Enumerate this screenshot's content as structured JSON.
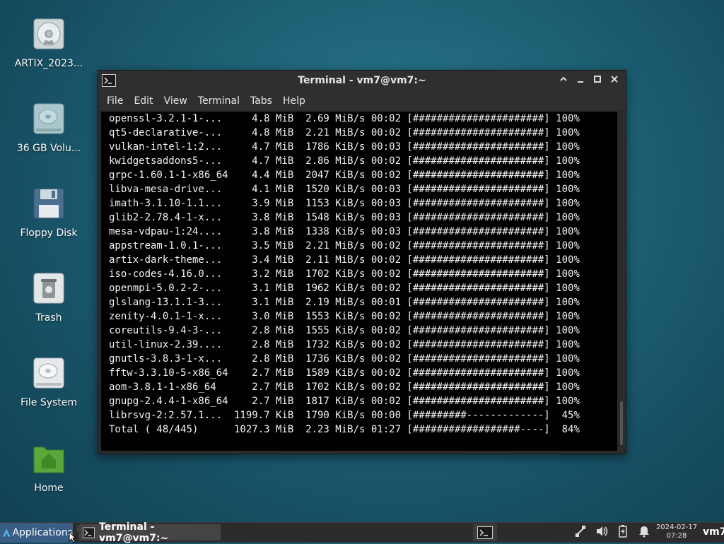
{
  "desktop": {
    "icons": [
      {
        "label": "ARTIX_2023...",
        "icon": "optical-disc-icon"
      },
      {
        "label": "36 GB Volu...",
        "icon": "hard-drive-icon"
      },
      {
        "label": "Floppy Disk",
        "icon": "floppy-disk-icon"
      },
      {
        "label": "Trash",
        "icon": "trash-icon"
      },
      {
        "label": "File System",
        "icon": "hard-drive-icon"
      },
      {
        "label": "Home",
        "icon": "home-folder-icon"
      }
    ]
  },
  "window": {
    "title": "Terminal - vm7@vm7:~",
    "menu": [
      "File",
      "Edit",
      "View",
      "Terminal",
      "Tabs",
      "Help"
    ],
    "lines": [
      "openssl-3.2.1-1-...     4.8 MiB  2.69 MiB/s 00:02 [######################] 100%",
      "qt5-declarative-...     4.8 MiB  2.21 MiB/s 00:02 [######################] 100%",
      "vulkan-intel-1:2...     4.7 MiB  1786 KiB/s 00:03 [######################] 100%",
      "kwidgetsaddons5-...     4.7 MiB  2.86 MiB/s 00:02 [######################] 100%",
      "grpc-1.60.1-1-x86_64    4.4 MiB  2047 KiB/s 00:02 [######################] 100%",
      "libva-mesa-drive...     4.1 MiB  1520 KiB/s 00:03 [######################] 100%",
      "imath-3.1.10-1.1...     3.9 MiB  1153 KiB/s 00:03 [######################] 100%",
      "glib2-2.78.4-1-x...     3.8 MiB  1548 KiB/s 00:03 [######################] 100%",
      "mesa-vdpau-1:24....     3.8 MiB  1338 KiB/s 00:03 [######################] 100%",
      "appstream-1.0.1-...     3.5 MiB  2.21 MiB/s 00:02 [######################] 100%",
      "artix-dark-theme...     3.4 MiB  2.11 MiB/s 00:02 [######################] 100%",
      "iso-codes-4.16.0...     3.2 MiB  1702 KiB/s 00:02 [######################] 100%",
      "openmpi-5.0.2-2-...     3.1 MiB  1962 KiB/s 00:02 [######################] 100%",
      "glslang-13.1.1-3...     3.1 MiB  2.19 MiB/s 00:01 [######################] 100%",
      "zenity-4.0.1-1-x...     3.0 MiB  1553 KiB/s 00:02 [######################] 100%",
      "coreutils-9.4-3-...     2.8 MiB  1555 KiB/s 00:02 [######################] 100%",
      "util-linux-2.39....     2.8 MiB  1732 KiB/s 00:02 [######################] 100%",
      "gnutls-3.8.3-1-x...     2.8 MiB  1736 KiB/s 00:02 [######################] 100%",
      "fftw-3.3.10-5-x86_64    2.7 MiB  1589 KiB/s 00:02 [######################] 100%",
      "aom-3.8.1-1-x86_64      2.7 MiB  1702 KiB/s 00:02 [######################] 100%",
      "gnupg-2.4.4-1-x86_64    2.7 MiB  1817 KiB/s 00:02 [######################] 100%",
      "librsvg-2:2.57.1...  1199.7 KiB  1790 KiB/s 00:00 [#########-------------]  45%",
      "Total ( 48/445)      1027.3 MiB  2.23 MiB/s 01:27 [##################----]  84%"
    ]
  },
  "taskbar": {
    "apps_label": "Applications",
    "task_label": "Terminal - vm7@vm7:~",
    "clock_date": "2024-02-17",
    "clock_time": "07:28",
    "user": "vm7"
  }
}
